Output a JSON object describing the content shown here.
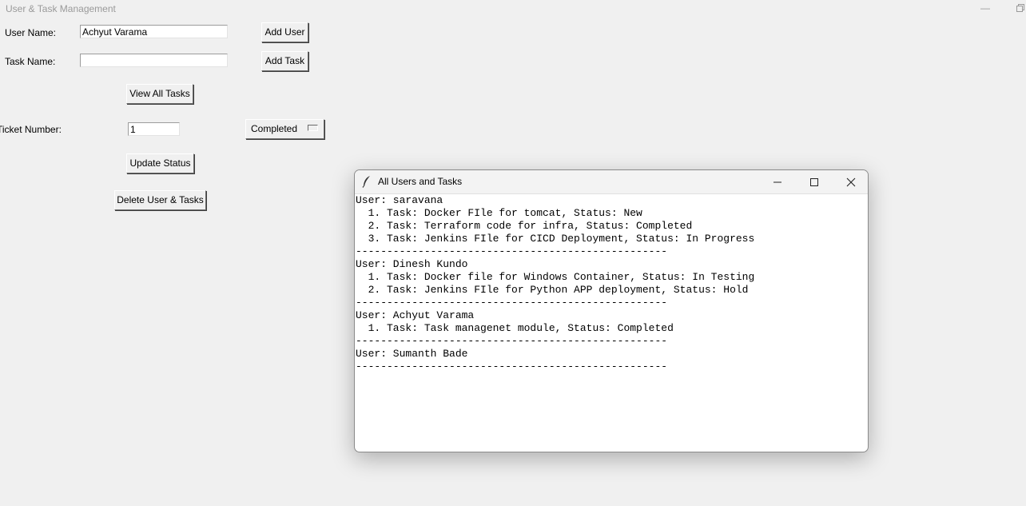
{
  "main_window": {
    "title": "User & Task Management"
  },
  "form": {
    "user_name_label": "User Name:",
    "user_name_value": "Achyut Varama",
    "add_user_label": "Add User",
    "task_name_label": "Task Name:",
    "task_name_value": "",
    "add_task_label": "Add Task",
    "view_all_label": "View All Tasks",
    "ticket_label": "Ticket Number:",
    "ticket_value": "1",
    "status_selected": "Completed",
    "update_status_label": "Update Status",
    "delete_label": "Delete User & Tasks"
  },
  "tasks_window": {
    "title": "All Users and Tasks",
    "lines": [
      "User: saravana",
      "  1. Task: Docker FIle for tomcat, Status: New",
      "  2. Task: Terraform code for infra, Status: Completed",
      "  3. Task: Jenkins FIle for CICD Deployment, Status: In Progress",
      "--------------------------------------------------",
      "User: Dinesh Kundo",
      "  1. Task: Docker file for Windows Container, Status: In Testing",
      "  2. Task: Jenkins FIle for Python APP deployment, Status: Hold",
      "--------------------------------------------------",
      "User: Achyut Varama",
      "  1. Task: Task managenet module, Status: Completed",
      "--------------------------------------------------",
      "User: Sumanth Bade",
      "--------------------------------------------------"
    ]
  }
}
